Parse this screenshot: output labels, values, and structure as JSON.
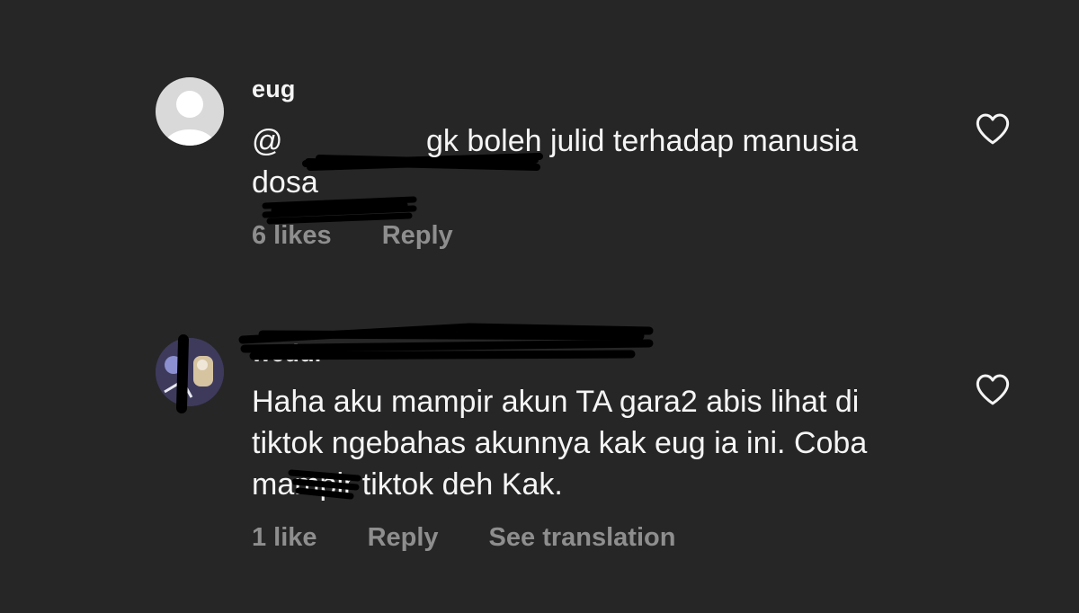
{
  "comments": [
    {
      "username": "eug",
      "text_prefix": "@",
      "text_body": " gk boleh julid terhadap manusia dosa",
      "likes": "6 likes",
      "reply": "Reply"
    },
    {
      "username": "weddi",
      "text": "Haha aku mampir akun TA gara2 abis lihat di tiktok ngebahas akunnya kak eug ia ini. Coba mampir tiktok deh Kak.",
      "likes": "1 like",
      "reply": "Reply",
      "translate": "See translation"
    }
  ],
  "icons": {
    "like": "heart-outline-icon",
    "default_avatar": "person-silhouette-icon"
  },
  "colors": {
    "background": "#262626",
    "text": "#f5f5f5",
    "meta": "#8e8e8e"
  }
}
